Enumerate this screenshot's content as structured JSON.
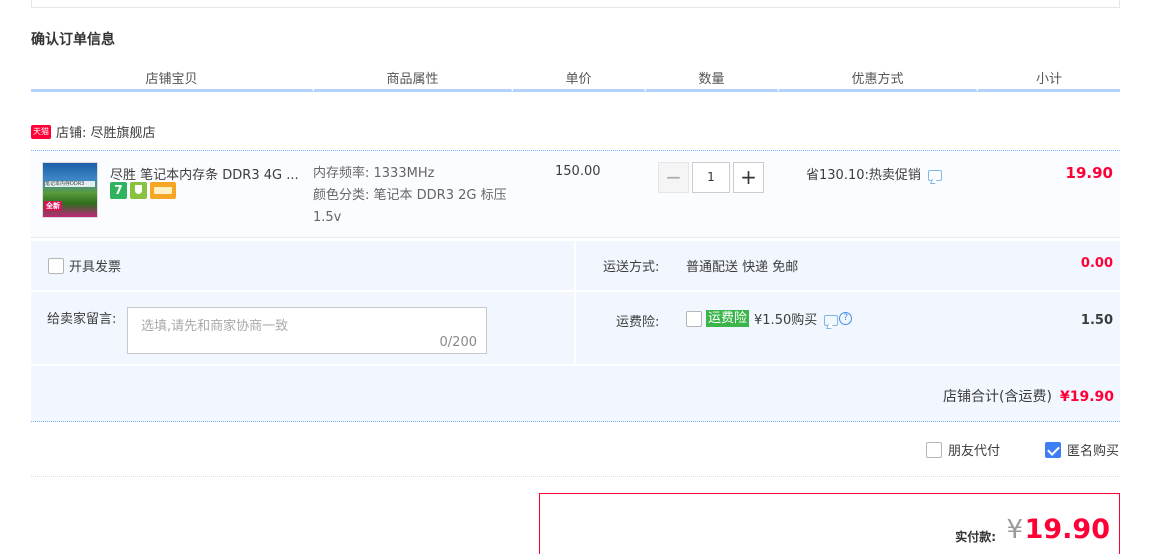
{
  "section_title": "确认订单信息",
  "columns": [
    "店铺宝贝",
    "商品属性",
    "单价",
    "数量",
    "优惠方式",
    "小计"
  ],
  "shop": {
    "badge": "天猫",
    "label": "店铺: 尽胜旗舰店"
  },
  "item": {
    "thumb_text": "笔记本内存DDR3",
    "thumb_tag": "全新",
    "title": "尽胜 笔记本内存条 DDR3 4G ...",
    "badges": [
      "7",
      "shield",
      "card"
    ],
    "attrs": [
      "内存频率: 1333MHz",
      "颜色分类: 笔记本 DDR3 2G 标压 1.5v"
    ],
    "price": "150.00",
    "quantity": "1",
    "qty_minus": "−",
    "qty_plus": "+",
    "promo": "省130.10:热卖促销",
    "subtotal": "19.90"
  },
  "invoice_label": "开具发票",
  "shipping": {
    "label": "运送方式:",
    "value": "普通配送 快递 免邮",
    "fee": "0.00"
  },
  "message": {
    "label": "给卖家留言:",
    "placeholder": "选填,请先和商家协商一致",
    "counter": "0/200"
  },
  "insurance": {
    "label": "运费险:",
    "tag": "运费险",
    "text": "¥1.50购买",
    "help": "?",
    "fee": "1.50"
  },
  "shop_total": {
    "label": "店铺合计(含运费)",
    "amount": "¥19.90"
  },
  "options": {
    "friend_pay": "朋友代付",
    "anonymous": "匿名购买",
    "anonymous_checked": true
  },
  "payment": {
    "label": "实付款:",
    "currency": "¥",
    "amount": "19.90"
  },
  "colors": {
    "accent": "#ff0036",
    "header_line": "#b2d1ff",
    "row_bg": "#f2f7ff",
    "check": "#3d7ef2"
  }
}
